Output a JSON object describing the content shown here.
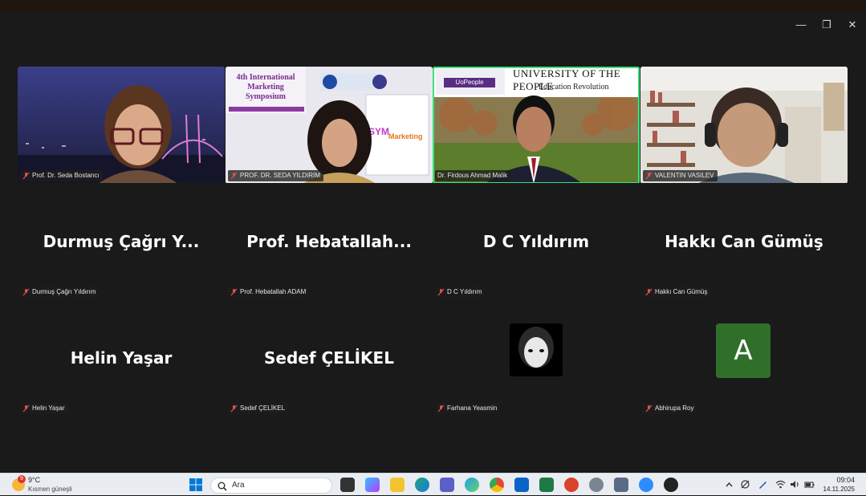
{
  "meeting": {
    "video_tiles": [
      {
        "tag": "Prof. Dr. Seda Bostancı"
      },
      {
        "tag": "PROF. DR. SEDA YILDIRIM",
        "slide_title": "4th International Marketing Symposium"
      },
      {
        "tag": "Dr. Firdous Ahmad Malik",
        "banner_title": "UNIVERSITY OF THE PEOPLE",
        "banner_sub": "Education Revolution",
        "logo": "UoPeople"
      },
      {
        "tag": "VALENTIN VASILEV"
      }
    ],
    "name_tiles": [
      {
        "display": "Durmuş Çağrı Y...",
        "tag": "Durmuş Çağrı Yıldırım"
      },
      {
        "display": "Prof.  Hebatallah...",
        "tag": "Prof. Hebatallah ADAM"
      },
      {
        "display": "D C Yıldırım",
        "tag": "D C Yıldırım"
      },
      {
        "display": "Hakkı Can Gümüş",
        "tag": "Hakkı Can Gümüş"
      },
      {
        "display": "Helin Yaşar",
        "tag": "Helin Yaşar"
      },
      {
        "display": "Sedef ÇELİKEL",
        "tag": "Sedef ÇELİKEL"
      }
    ],
    "avatar_tiles": [
      {
        "tag": "Farhana Yeasmin"
      },
      {
        "letter": "A",
        "tag": "Abhirupa Roy"
      }
    ],
    "window_controls": {
      "minimize": "—",
      "restore": "❐",
      "close": "✕"
    }
  },
  "taskbar": {
    "weather": {
      "temp": "9°C",
      "desc": "Kısmen güneşli",
      "badge": "9"
    },
    "search_placeholder": "Ara",
    "clock": {
      "time": "09:04",
      "date": "14.11.2025"
    },
    "colors": {
      "accent": "#0078d4",
      "muted_mic": "#d9534f",
      "active_speaker": "#3ee07a"
    }
  }
}
